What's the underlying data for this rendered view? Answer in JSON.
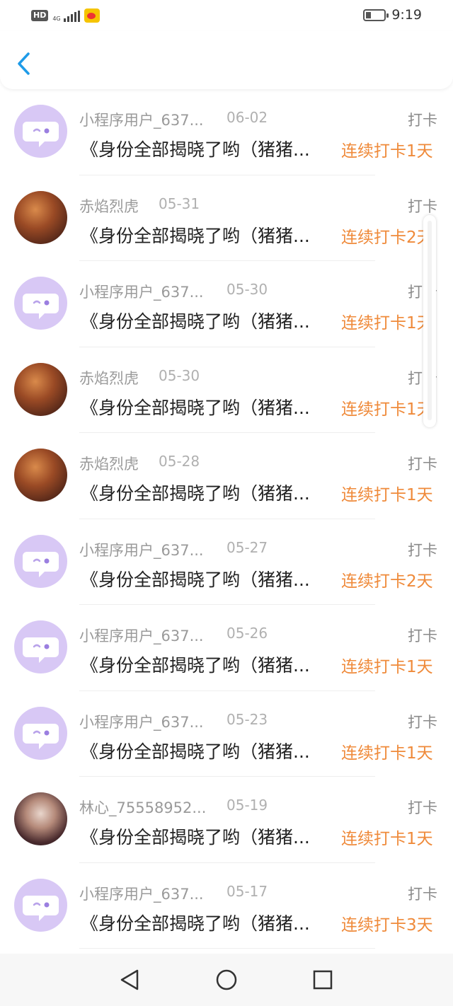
{
  "status_bar": {
    "network_badge": "HD",
    "network_type": "4G",
    "time": "9:19"
  },
  "header": {
    "back_icon": "chevron-left-icon",
    "accent_color": "#1e9be8"
  },
  "list": {
    "type_color": "#8a8a8a",
    "streak_color": "#ef8a3a",
    "items": [
      {
        "avatar": "bot",
        "name": "小程序用户_637...",
        "date": "06-02",
        "type": "打卡",
        "title": "《身份全部揭晓了哟（猪猪...",
        "streak": "连续打卡1天"
      },
      {
        "avatar": "fire",
        "name": "赤焰烈虎",
        "date": "05-31",
        "type": "打卡",
        "title": "《身份全部揭晓了哟（猪猪...",
        "streak": "连续打卡2天"
      },
      {
        "avatar": "bot",
        "name": "小程序用户_637...",
        "date": "05-30",
        "type": "打卡",
        "title": "《身份全部揭晓了哟（猪猪...",
        "streak": "连续打卡1天"
      },
      {
        "avatar": "fire",
        "name": "赤焰烈虎",
        "date": "05-30",
        "type": "打卡",
        "title": "《身份全部揭晓了哟（猪猪...",
        "streak": "连续打卡1天"
      },
      {
        "avatar": "fire",
        "name": "赤焰烈虎",
        "date": "05-28",
        "type": "打卡",
        "title": "《身份全部揭晓了哟（猪猪...",
        "streak": "连续打卡1天"
      },
      {
        "avatar": "bot",
        "name": "小程序用户_637...",
        "date": "05-27",
        "type": "打卡",
        "title": "《身份全部揭晓了哟（猪猪...",
        "streak": "连续打卡2天"
      },
      {
        "avatar": "bot",
        "name": "小程序用户_637...",
        "date": "05-26",
        "type": "打卡",
        "title": "《身份全部揭晓了哟（猪猪...",
        "streak": "连续打卡1天"
      },
      {
        "avatar": "bot",
        "name": "小程序用户_637...",
        "date": "05-23",
        "type": "打卡",
        "title": "《身份全部揭晓了哟（猪猪...",
        "streak": "连续打卡1天"
      },
      {
        "avatar": "girl",
        "name": "林心_75558952...",
        "date": "05-19",
        "type": "打卡",
        "title": "《身份全部揭晓了哟（猪猪...",
        "streak": "连续打卡1天"
      },
      {
        "avatar": "bot",
        "name": "小程序用户_637...",
        "date": "05-17",
        "type": "打卡",
        "title": "《身份全部揭晓了哟（猪猪...",
        "streak": "连续打卡3天"
      }
    ]
  },
  "nav_bar": {
    "back_icon": "triangle-back-icon",
    "home_icon": "circle-home-icon",
    "recents_icon": "square-recents-icon"
  }
}
